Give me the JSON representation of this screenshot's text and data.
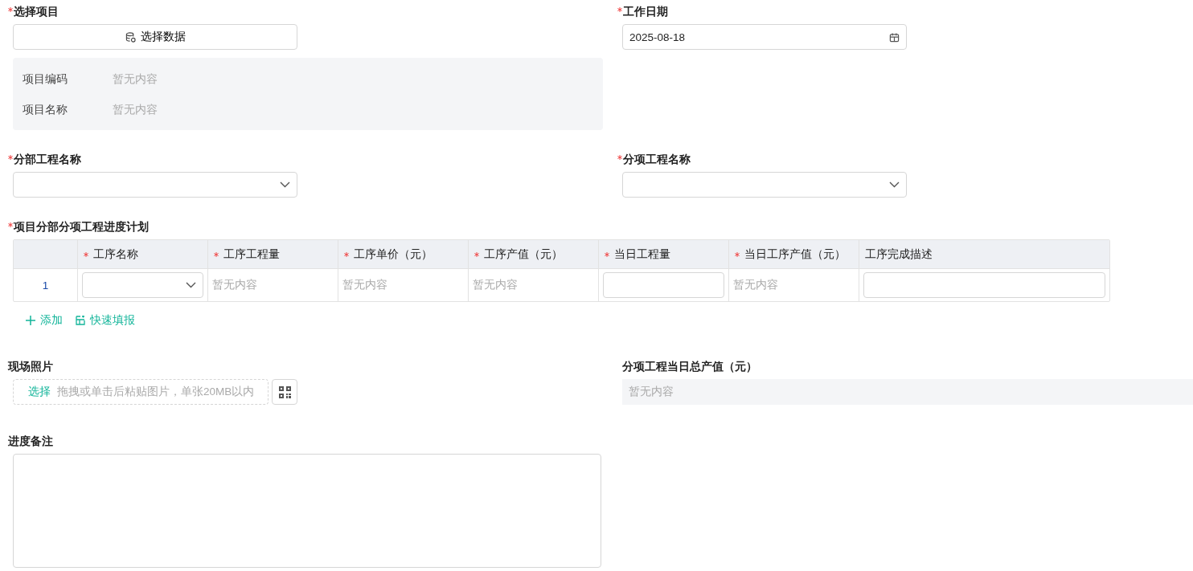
{
  "project": {
    "label": "选择项目",
    "required": true,
    "button": "选择数据",
    "info": [
      {
        "label": "项目编码",
        "value": "暂无内容"
      },
      {
        "label": "项目名称",
        "value": "暂无内容"
      }
    ]
  },
  "work_date": {
    "label": "工作日期",
    "required": true,
    "value": "2025-08-18"
  },
  "division": {
    "label": "分部工程名称",
    "required": true
  },
  "subitem": {
    "label": "分项工程名称",
    "required": true
  },
  "plan": {
    "label": "项目分部分项工程进度计划",
    "required": true,
    "columns": [
      {
        "label": "工序名称",
        "required": true
      },
      {
        "label": "工序工程量",
        "required": true
      },
      {
        "label": "工序单价（元）",
        "required": true
      },
      {
        "label": "工序产值（元）",
        "required": true
      },
      {
        "label": "当日工程量",
        "required": true
      },
      {
        "label": "当日工序产值（元）",
        "required": true
      },
      {
        "label": "工序完成描述",
        "required": false
      }
    ],
    "rows": [
      {
        "index": "1",
        "cells": [
          {
            "kind": "select"
          },
          {
            "kind": "text",
            "value": "暂无内容"
          },
          {
            "kind": "text",
            "value": "暂无内容"
          },
          {
            "kind": "text",
            "value": "暂无内容"
          },
          {
            "kind": "input"
          },
          {
            "kind": "text",
            "value": "暂无内容"
          },
          {
            "kind": "input"
          }
        ]
      }
    ],
    "actions": [
      {
        "label": "添加",
        "kind": "add"
      },
      {
        "label": "快速填报",
        "kind": "quick"
      }
    ]
  },
  "photos": {
    "label": "现场照片",
    "choose": "选择",
    "hint": "拖拽或单击后粘贴图片，单张20MB以内"
  },
  "total": {
    "label": "分项工程当日总产值（元）",
    "value": "暂无内容"
  },
  "remarks": {
    "label": "进度备注"
  }
}
